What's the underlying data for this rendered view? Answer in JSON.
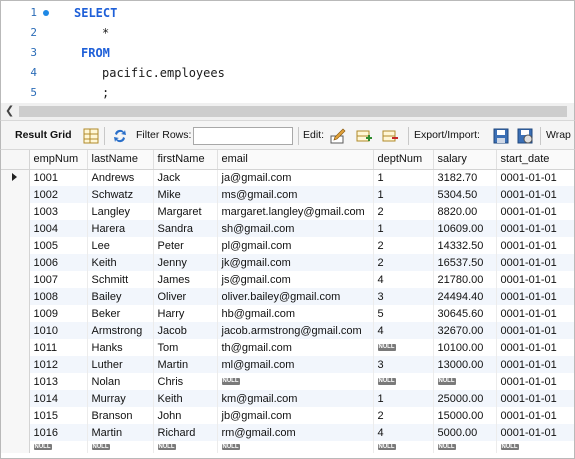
{
  "editor": {
    "lines": [
      {
        "num": "1",
        "text": "SELECT",
        "kind": "keyword"
      },
      {
        "num": "2",
        "text": "*",
        "kind": "ident"
      },
      {
        "num": "3",
        "text": "FROM",
        "kind": "keyword"
      },
      {
        "num": "4",
        "text": "pacific.employees",
        "kind": "ident"
      },
      {
        "num": "5",
        "text": ";",
        "kind": "ident"
      }
    ]
  },
  "toolbar": {
    "result_grid_label": "Result Grid",
    "filter_rows_label": "Filter Rows:",
    "filter_value": "",
    "edit_label": "Edit:",
    "export_import_label": "Export/Import:",
    "wrap_label": "Wrap"
  },
  "grid": {
    "columns": [
      "empNum",
      "lastName",
      "firstName",
      "email",
      "deptNum",
      "salary",
      "start_date"
    ],
    "null_label": "NULL",
    "rows": [
      [
        "1001",
        "Andrews",
        "Jack",
        "ja@gmail.com",
        "1",
        "3182.70",
        "0001-01-01"
      ],
      [
        "1002",
        "Schwatz",
        "Mike",
        "ms@gmail.com",
        "1",
        "5304.50",
        "0001-01-01"
      ],
      [
        "1003",
        "Langley",
        "Margaret",
        "margaret.langley@gmail.com",
        "2",
        "8820.00",
        "0001-01-01"
      ],
      [
        "1004",
        "Harera",
        "Sandra",
        "sh@gmail.com",
        "1",
        "10609.00",
        "0001-01-01"
      ],
      [
        "1005",
        "Lee",
        "Peter",
        "pl@gmail.com",
        "2",
        "14332.50",
        "0001-01-01"
      ],
      [
        "1006",
        "Keith",
        "Jenny",
        "jk@gmail.com",
        "2",
        "16537.50",
        "0001-01-01"
      ],
      [
        "1007",
        "Schmitt",
        "James",
        "js@gmail.com",
        "4",
        "21780.00",
        "0001-01-01"
      ],
      [
        "1008",
        "Bailey",
        "Oliver",
        "oliver.bailey@gmail.com",
        "3",
        "24494.40",
        "0001-01-01"
      ],
      [
        "1009",
        "Beker",
        "Harry",
        "hb@gmail.com",
        "5",
        "30645.60",
        "0001-01-01"
      ],
      [
        "1010",
        "Armstrong",
        "Jacob",
        "jacob.armstrong@gmail.com",
        "4",
        "32670.00",
        "0001-01-01"
      ],
      [
        "1011",
        "Hanks",
        "Tom",
        "th@gmail.com",
        null,
        "10100.00",
        "0001-01-01"
      ],
      [
        "1012",
        "Luther",
        "Martin",
        "ml@gmail.com",
        "3",
        "13000.00",
        "0001-01-01"
      ],
      [
        "1013",
        "Nolan",
        "Chris",
        null,
        null,
        null,
        "0001-01-01"
      ],
      [
        "1014",
        "Murray",
        "Keith",
        "km@gmail.com",
        "1",
        "25000.00",
        "0001-01-01"
      ],
      [
        "1015",
        "Branson",
        "John",
        "jb@gmail.com",
        "2",
        "15000.00",
        "0001-01-01"
      ],
      [
        "1016",
        "Martin",
        "Richard",
        "rm@gmail.com",
        "4",
        "5000.00",
        "0001-01-01"
      ]
    ]
  },
  "colors": {
    "keyword": "#1e5fd8",
    "line_number": "#2b6cb7",
    "row_alt": "#f2f6fc",
    "null_badge": "#7a7a7a"
  }
}
